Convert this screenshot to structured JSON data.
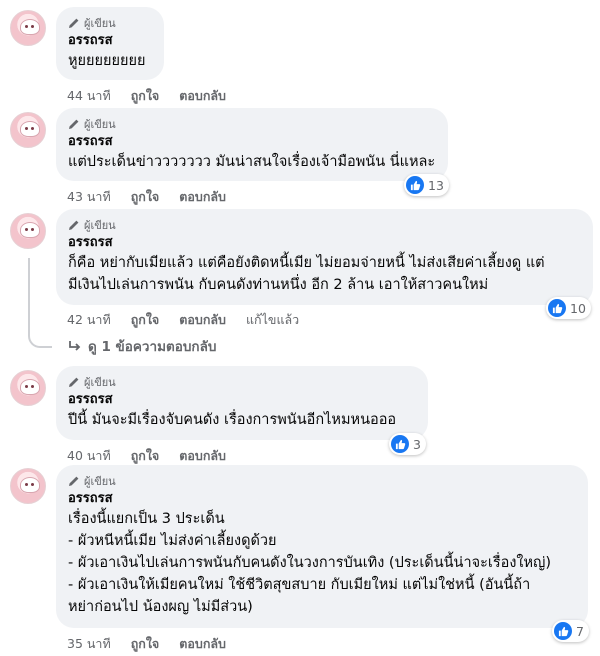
{
  "author_badge": "ผู้เขียน",
  "colors": {
    "bubble": "#f0f2f5",
    "meta_text": "#65676b",
    "like_blue": "#1877f2"
  },
  "icons": {
    "badge": "pencil-icon",
    "reaction": "thumbs-up-icon",
    "reply_arrow": "reply-arrow-icon"
  },
  "comments": [
    {
      "name": "อรรถรส",
      "lines": [
        "หูยยยยยยยย"
      ],
      "time": "44 นาที",
      "like": "ถูกใจ",
      "reply": "ตอบกลับ"
    },
    {
      "name": "อรรถรส",
      "lines": [
        "แต่ประเด็นข่าววววววว มันน่าสนใจเรื่องเจ้ามือพนัน นี่แหละ"
      ],
      "time": "43 นาที",
      "like": "ถูกใจ",
      "reply": "ตอบกลับ",
      "reactions": "13"
    },
    {
      "name": "อรรถรส",
      "lines": [
        "ก็คือ หย่ากับเมียแล้ว แต่คือยังติดหนี้เมีย ไม่ยอมจ่ายหนี้ ไม่ส่งเสียค่าเลี้ยงดู แต่",
        "มีเงินไปเล่นการพนัน กับคนดังท่านหนึ่ง อีก 2 ล้าน เอาให้สาวคนใหม่"
      ],
      "time": "42 นาที",
      "like": "ถูกใจ",
      "reply": "ตอบกลับ",
      "edited": "แก้ไขแล้ว",
      "reactions": "10"
    },
    {
      "name": "อรรถรส",
      "lines": [
        "ปีนี้ มันจะมีเรื่องจับคนดัง เรื่องการพนันอีกไหมหนอออ"
      ],
      "time": "40 นาที",
      "like": "ถูกใจ",
      "reply": "ตอบกลับ",
      "reactions": "3"
    },
    {
      "name": "อรรถรส",
      "lines": [
        "เรื่องนี้แยกเป็น 3 ประเด็น",
        "- ผัวหนีหนี้เมีย ไม่ส่งค่าเลี้ยงดูด้วย",
        "- ผัวเอาเงินไปเล่นการพนันกับคนดังในวงการบันเทิง (ประเด็นนี้น่าจะเรื่องใหญ่)",
        "- ผัวเอาเงินให้เมียคนใหม่ ใช้ชีวิตสุขสบาย กับเมียใหม่ แต่ไม่ใช่หนี้ (อันนี้ถ้า",
        "หย่าก่อนไป น้องผญ ไม่มีส่วน)"
      ],
      "time": "35 นาที",
      "like": "ถูกใจ",
      "reply": "ตอบกลับ",
      "reactions": "7"
    }
  ],
  "replies_link": "ดู 1 ข้อความตอบกลับ"
}
